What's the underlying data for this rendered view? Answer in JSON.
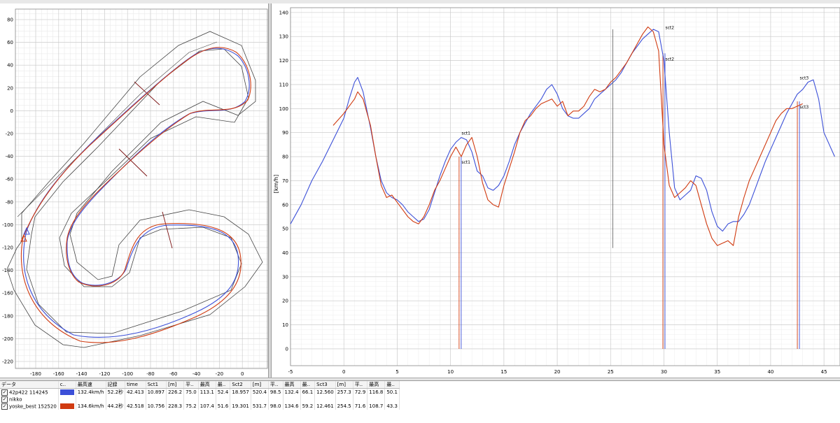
{
  "colors": {
    "blue_lap": "#3c50d8",
    "red_lap": "#d03a10",
    "boundary": "#444444",
    "grid": "#d4d4d4"
  },
  "track_map": {
    "x_ticks": [
      "-180",
      "-160",
      "-140",
      "-120",
      "-100",
      "-80",
      "-60",
      "-40",
      "-20",
      "0"
    ],
    "y_ticks": [
      "80",
      "60",
      "40",
      "20",
      "0",
      "-20",
      "-40",
      "-60",
      "-80",
      "-100",
      "-120",
      "-140",
      "-160",
      "-180",
      "-200",
      "-220"
    ]
  },
  "chart_data": {
    "type": "line",
    "ylabel": "[km/h]",
    "x_ticks": [
      "-5",
      "0",
      "5",
      "10",
      "15",
      "20",
      "25",
      "30",
      "35",
      "40",
      "45"
    ],
    "y_ticks": [
      "140",
      "130",
      "120",
      "110",
      "100",
      "90",
      "80",
      "70",
      "60",
      "50",
      "40",
      "30",
      "20",
      "10",
      "0"
    ],
    "xlim": [
      -5,
      46.5
    ],
    "ylim": [
      -7,
      142
    ],
    "series": [
      {
        "color": "#3c50d8",
        "x": [
          -5,
          -4,
          -3,
          -2,
          -1,
          0,
          0.5,
          1,
          1.3,
          1.8,
          2.5,
          3,
          3.5,
          4,
          4.5,
          5,
          5.5,
          6,
          6.5,
          7,
          7.5,
          8,
          8.5,
          9,
          9.5,
          10,
          10.5,
          11,
          11.5,
          12,
          12.5,
          13,
          13.5,
          14,
          14.5,
          15,
          15.5,
          16,
          16.5,
          17,
          17.5,
          18,
          18.5,
          19,
          19.5,
          20,
          20.5,
          21,
          21.5,
          22,
          22.5,
          23,
          23.5,
          24,
          24.5,
          25,
          25.5,
          26,
          26.5,
          27,
          27.5,
          28,
          28.5,
          29,
          29.5,
          30,
          30.5,
          31,
          31.5,
          32,
          32.5,
          33,
          33.5,
          34,
          34.5,
          35,
          35.5,
          36,
          36.5,
          37,
          37.5,
          38,
          38.5,
          39,
          39.5,
          40,
          40.5,
          41,
          41.5,
          42,
          42.5,
          43,
          43.5,
          44,
          44.5,
          45,
          46
        ],
        "y": [
          52,
          60,
          70,
          78,
          87,
          96,
          104,
          111,
          113,
          107,
          92,
          80,
          70,
          65,
          63,
          62,
          60,
          57,
          55,
          53,
          54,
          58,
          65,
          72,
          78,
          83,
          86,
          88,
          87,
          82,
          74,
          72,
          67,
          66,
          68,
          72,
          78,
          85,
          90,
          94,
          98,
          101,
          104,
          108,
          110,
          106,
          100,
          97,
          96,
          96,
          98,
          100,
          104,
          106,
          108,
          110,
          112,
          115,
          119,
          123,
          126,
          129,
          131,
          133,
          132,
          120,
          90,
          67,
          62,
          64,
          66,
          72,
          71,
          66,
          57,
          51,
          49,
          52,
          53,
          53,
          56,
          60,
          66,
          72,
          78,
          83,
          88,
          93,
          98,
          102,
          106,
          108,
          111,
          112,
          104,
          90,
          80
        ]
      },
      {
        "color": "#d03a10",
        "x": [
          -1,
          0,
          0.5,
          1,
          1.3,
          1.8,
          2.5,
          3,
          3.5,
          4,
          4.5,
          5,
          5.5,
          6,
          6.5,
          7,
          7.5,
          8,
          8.5,
          9,
          9.5,
          10,
          10.5,
          11,
          11.5,
          12,
          12.5,
          13,
          13.5,
          14,
          14.5,
          15,
          15.5,
          16,
          16.5,
          17,
          17.5,
          18,
          18.5,
          19,
          19.5,
          20,
          20.5,
          21,
          21.5,
          22,
          22.5,
          23,
          23.5,
          24,
          24.5,
          25,
          25.5,
          26,
          26.5,
          27,
          27.5,
          28,
          28.5,
          29,
          29.5,
          30,
          30.5,
          31,
          31.5,
          32,
          32.5,
          33,
          33.5,
          34,
          34.5,
          35,
          35.5,
          36,
          36.5,
          37,
          37.5,
          38,
          38.5,
          39,
          39.5,
          40,
          40.5,
          41,
          41.5,
          42,
          42.5,
          43
        ],
        "y": [
          93,
          98,
          101,
          104,
          107,
          104,
          93,
          80,
          68,
          63,
          64,
          61,
          58,
          55,
          53,
          52,
          55,
          60,
          66,
          70,
          75,
          80,
          84,
          80,
          85,
          88,
          80,
          69,
          62,
          60,
          59,
          68,
          75,
          82,
          90,
          95,
          97,
          100,
          102,
          103,
          104,
          101,
          103,
          97,
          99,
          99,
          101,
          105,
          108,
          107,
          108,
          111,
          113,
          116,
          119,
          123,
          127,
          131,
          134,
          132,
          124,
          85,
          68,
          63,
          65,
          67,
          70,
          68,
          60,
          52,
          46,
          43,
          44,
          45,
          43,
          55,
          63,
          70,
          75,
          80,
          85,
          90,
          95,
          98,
          100,
          100,
          101,
          102
        ]
      }
    ],
    "sector_markers": [
      {
        "x": 10.9,
        "label_top": "sct1",
        "label_bottom": "sct1",
        "y_top": 88,
        "y_bottom": 80
      },
      {
        "x": 30.0,
        "label_top": "sct2",
        "label_bottom": "sct2",
        "y_top": 132,
        "y_bottom": 123
      },
      {
        "x": 42.6,
        "label_top": "sct3",
        "label_bottom": "sct3",
        "y_top": 111,
        "y_bottom": 103
      }
    ],
    "cursor_x": 25.2
  },
  "table": {
    "headers": [
      "データ",
      "c..",
      "最高速",
      "記録",
      "time",
      "Sct1",
      "[m]",
      "平..",
      "最高",
      "最..",
      "Sct2",
      "[m]",
      "平..",
      "最高",
      "最..",
      "Sct3",
      "[m]",
      "平..",
      "最高",
      "最.."
    ],
    "rows": [
      {
        "checked": true,
        "name": "42p422 114245",
        "color": "#3c50d8",
        "cells": [
          "132.4km/h",
          "52.2秒",
          "42.413",
          "10.897",
          "226.2",
          "75.0",
          "113.1",
          "52.4",
          "18.957",
          "520.4",
          "98.5",
          "132.4",
          "66.1",
          "12.560",
          "257.3",
          "72.9",
          "116.8",
          "50.1"
        ]
      },
      {
        "checked": true,
        "name": "nikko",
        "color": "",
        "cells": [
          "",
          "",
          "",
          "",
          "",
          "",
          "",
          "",
          "",
          "",
          "",
          "",
          "",
          "",
          "",
          "",
          "",
          ""
        ]
      },
      {
        "checked": true,
        "name": "yoske_best 152520",
        "color": "#d03a10",
        "cells": [
          "134.6km/h",
          "44.2秒",
          "42.518",
          "10.756",
          "228.3",
          "75.2",
          "107.4",
          "51.6",
          "19.301",
          "531.7",
          "98.0",
          "134.6",
          "59.2",
          "12.461",
          "254.5",
          "71.6",
          "108.7",
          "43.3"
        ]
      }
    ]
  }
}
